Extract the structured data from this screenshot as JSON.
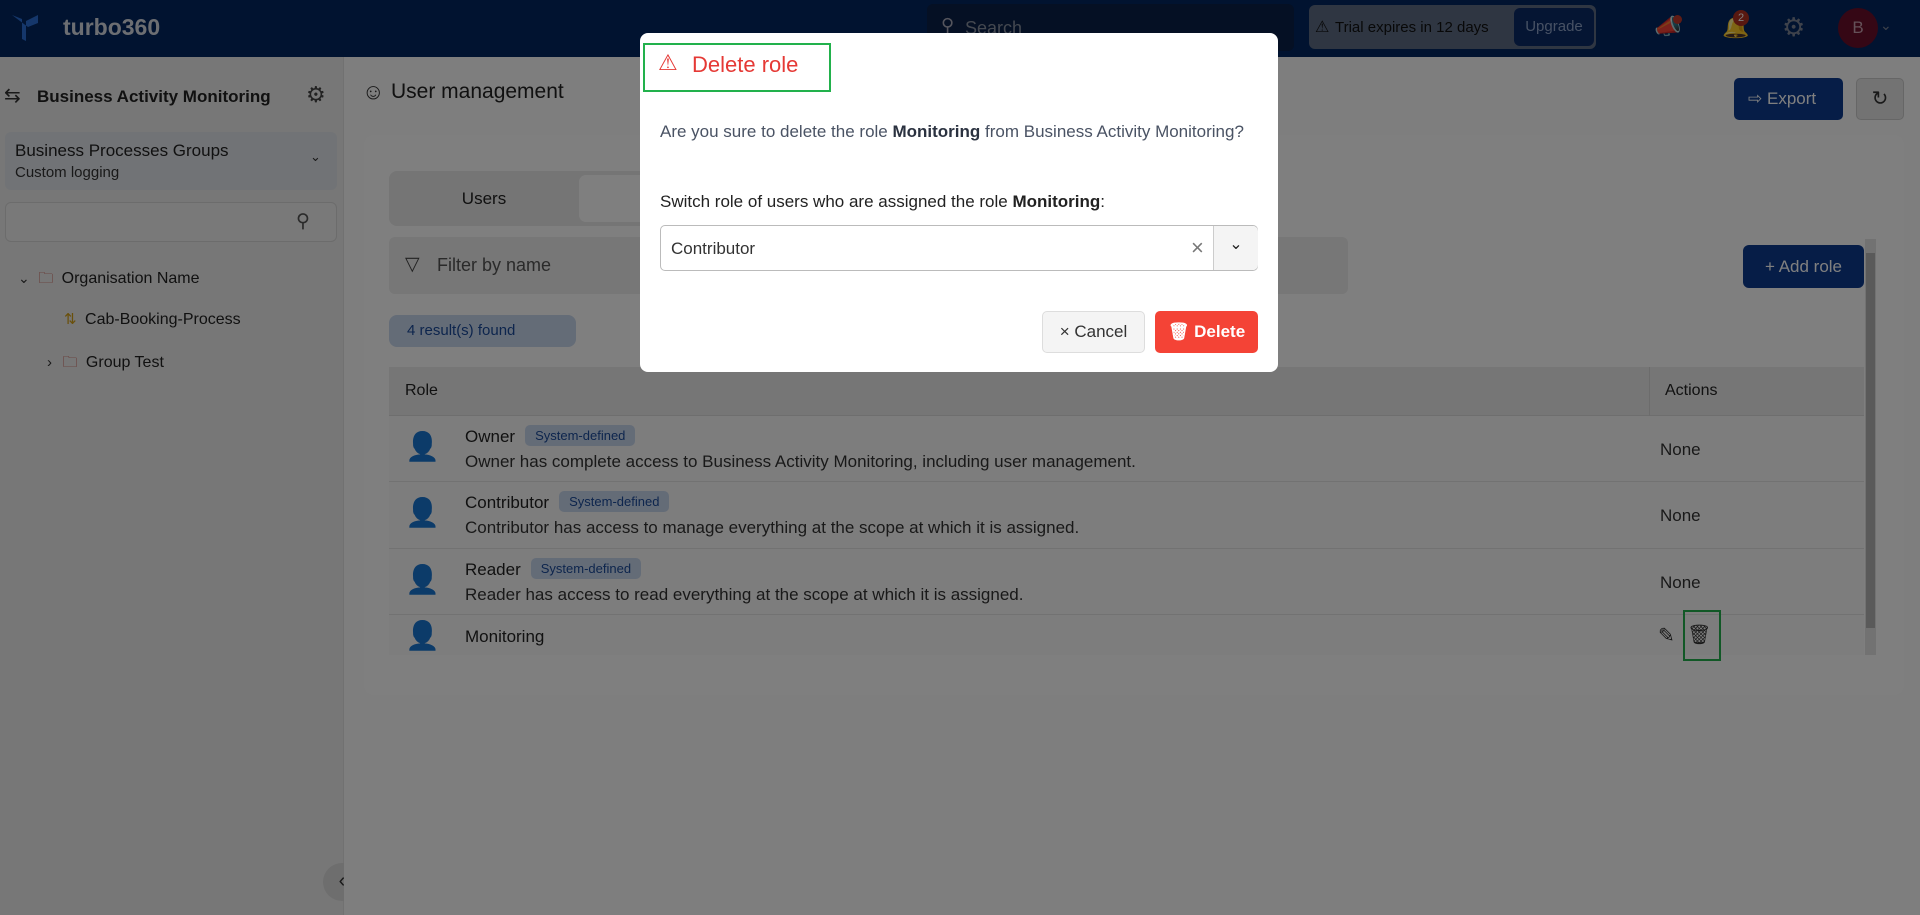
{
  "header": {
    "app_name": "turbo360",
    "search_placeholder": "Search",
    "trial_text": "Trial expires in 12 days",
    "upgrade_label": "Upgrade",
    "notification_count": "2",
    "avatar_initial": "B"
  },
  "sidebar": {
    "title": "Business Activity Monitoring",
    "group_selector": {
      "title": "Business Processes Groups",
      "subtitle": "Custom logging"
    },
    "search_placeholder": "",
    "tree": [
      {
        "label": "Organisation Name",
        "expanded": true
      },
      {
        "label": "Cab-Booking-Process"
      },
      {
        "label": "Group Test",
        "expanded": false
      }
    ]
  },
  "main": {
    "title": "User management",
    "export_label": "Export",
    "tabs": [
      {
        "label": "Users",
        "active": false
      }
    ],
    "filter_placeholder": "Filter by name",
    "add_role_label": "+ Add role",
    "results": "4 result(s) found",
    "table": {
      "headers": [
        "Role",
        "Actions"
      ],
      "rows": [
        {
          "name": "Owner",
          "badge": "System-defined",
          "description": "Owner has complete access to Business Activity Monitoring, including user management.",
          "actions": "None"
        },
        {
          "name": "Contributor",
          "badge": "System-defined",
          "description": "Contributor has access to manage everything at the scope at which it is assigned.",
          "actions": "None"
        },
        {
          "name": "Reader",
          "badge": "System-defined",
          "description": "Reader has access to read everything at the scope at which it is assigned.",
          "actions": "None"
        },
        {
          "name": "Monitoring",
          "badge": "",
          "description": "",
          "actions": ""
        }
      ]
    }
  },
  "modal": {
    "title": "Delete role",
    "message_pre": "Are you sure to delete the role ",
    "role": "Monitoring",
    "message_post": " from Business Activity Monitoring?",
    "switch_label_pre": "Switch role of users who are assigned the role ",
    "switch_label_post": ":",
    "selected_role": "Contributor",
    "cancel_label": "Cancel",
    "delete_label": "Delete"
  },
  "colors": {
    "header": "#022660",
    "primary": "#0d3b8f",
    "danger": "#f44336",
    "highlight": "#22b14c"
  }
}
